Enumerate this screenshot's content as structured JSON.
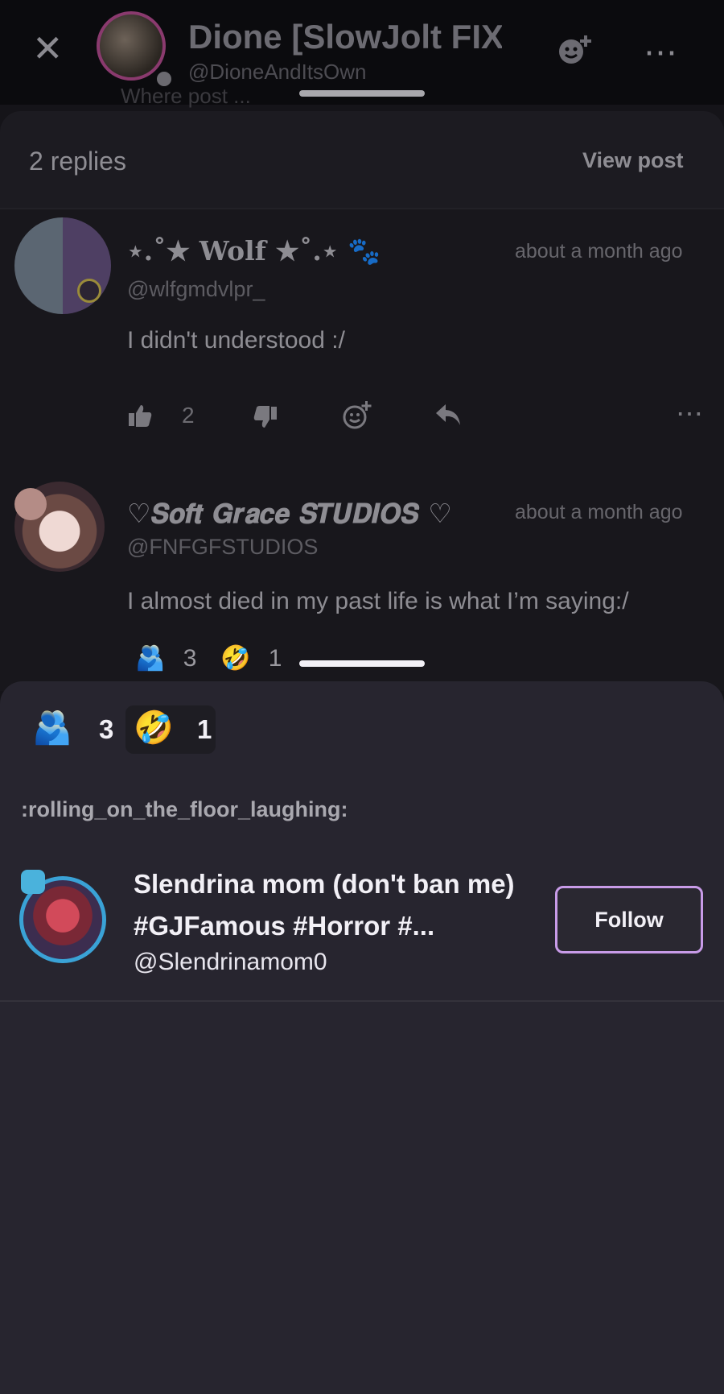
{
  "header": {
    "close_icon": "close-icon",
    "title": "Dione [SlowJolt FIX",
    "handle": "@DioneAndItsOwn",
    "peek_text": "Where post ..."
  },
  "replies": {
    "count_label": "2 replies",
    "view_post_label": "View post",
    "items": [
      {
        "name": "⋆.˚★ Wolf ★˚.⋆ 🐾",
        "handle": "@wlfgmdvlpr_",
        "time": "about a month ago",
        "text": "I didn't understood :/",
        "like_count": "2"
      },
      {
        "name": "♡𝑺𝒐𝒇𝒕 𝑮𝒓𝒂𝒄𝒆 𝑺𝑻𝑼𝑫𝑰𝑶𝑺 ♡",
        "handle": "@FNFGFSTUDIOS",
        "time": "about a month ago",
        "text": "I almost died in my past life is what I’m saying:/",
        "reactions": [
          {
            "emoji": "🫂",
            "count": "3"
          },
          {
            "emoji": "🤣",
            "count": "1"
          }
        ]
      }
    ]
  },
  "reaction_sheet": {
    "tabs": [
      {
        "emoji": "🫂",
        "count": "3"
      },
      {
        "emoji": "🤣",
        "count": "1"
      }
    ],
    "emoji_label": ":rolling_on_the_floor_laughing:",
    "users": [
      {
        "name": "Slendrina mom (don't ban me) #GJFamous #Horror #...",
        "handle": "@Slendrinamom0",
        "follow_label": "Follow"
      }
    ]
  },
  "colors": {
    "follow_border": "#c89be8",
    "avatar_ring": "#3aa2d6",
    "sheet_bg": "#27252f"
  }
}
